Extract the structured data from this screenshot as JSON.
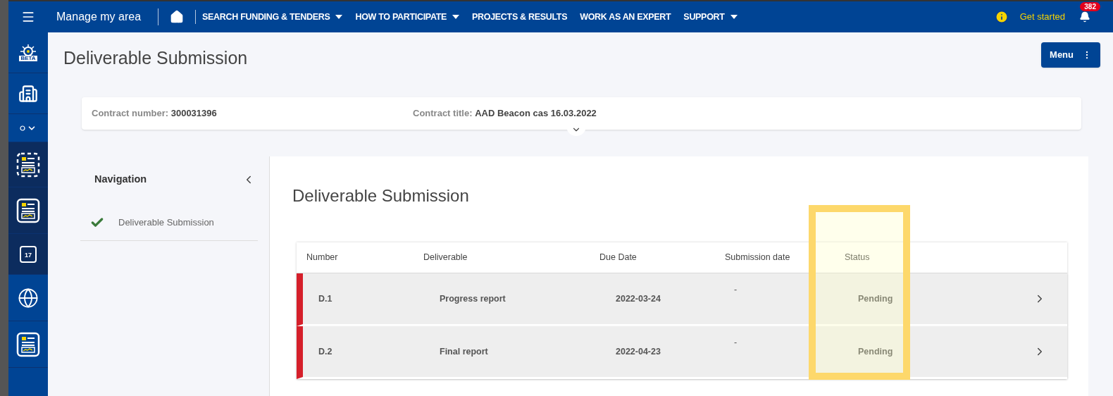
{
  "top_bar": {
    "app_title": "Manage my area",
    "nav": [
      {
        "label": "SEARCH FUNDING & TENDERS",
        "dropdown": true
      },
      {
        "label": "HOW TO PARTICIPATE",
        "dropdown": true
      },
      {
        "label": "PROJECTS & RESULTS",
        "dropdown": false
      },
      {
        "label": "WORK AS AN EXPERT",
        "dropdown": false
      },
      {
        "label": "SUPPORT",
        "dropdown": true
      }
    ],
    "get_started": "Get started",
    "notification_count": "382"
  },
  "sidebar": {
    "items": [
      {
        "kind": "beta",
        "nested": false,
        "badge": "BETA"
      },
      {
        "kind": "building",
        "nested": false
      },
      {
        "kind": "toggle",
        "nested": false
      },
      {
        "kind": "doc-dashed",
        "nested": true
      },
      {
        "kind": "doc",
        "nested": true
      },
      {
        "kind": "calendar",
        "nested": true,
        "day": "17"
      },
      {
        "kind": "globe",
        "nested": false
      },
      {
        "kind": "doc",
        "nested": false
      }
    ]
  },
  "page": {
    "title": "Deliverable Submission",
    "menu_button": "Menu"
  },
  "contract": {
    "number_label": "Contract number:",
    "number": "300031396",
    "title_label": "Contract title:",
    "title": "AAD Beacon cas 16.03.2022"
  },
  "navigation": {
    "title": "Navigation",
    "items": [
      {
        "label": "Deliverable Submission",
        "done": true
      }
    ]
  },
  "content": {
    "title": "Deliverable Submission",
    "table": {
      "columns": [
        "Number",
        "Deliverable",
        "Due Date",
        "Submission date",
        "Status"
      ],
      "rows": [
        {
          "number": "D.1",
          "deliverable": "Progress report",
          "due_date": "2022-03-24",
          "submission_date": "-",
          "status": "Pending"
        },
        {
          "number": "D.2",
          "deliverable": "Final report",
          "due_date": "2022-04-23",
          "submission_date": "-",
          "status": "Pending"
        }
      ]
    },
    "highlight_status": true
  }
}
